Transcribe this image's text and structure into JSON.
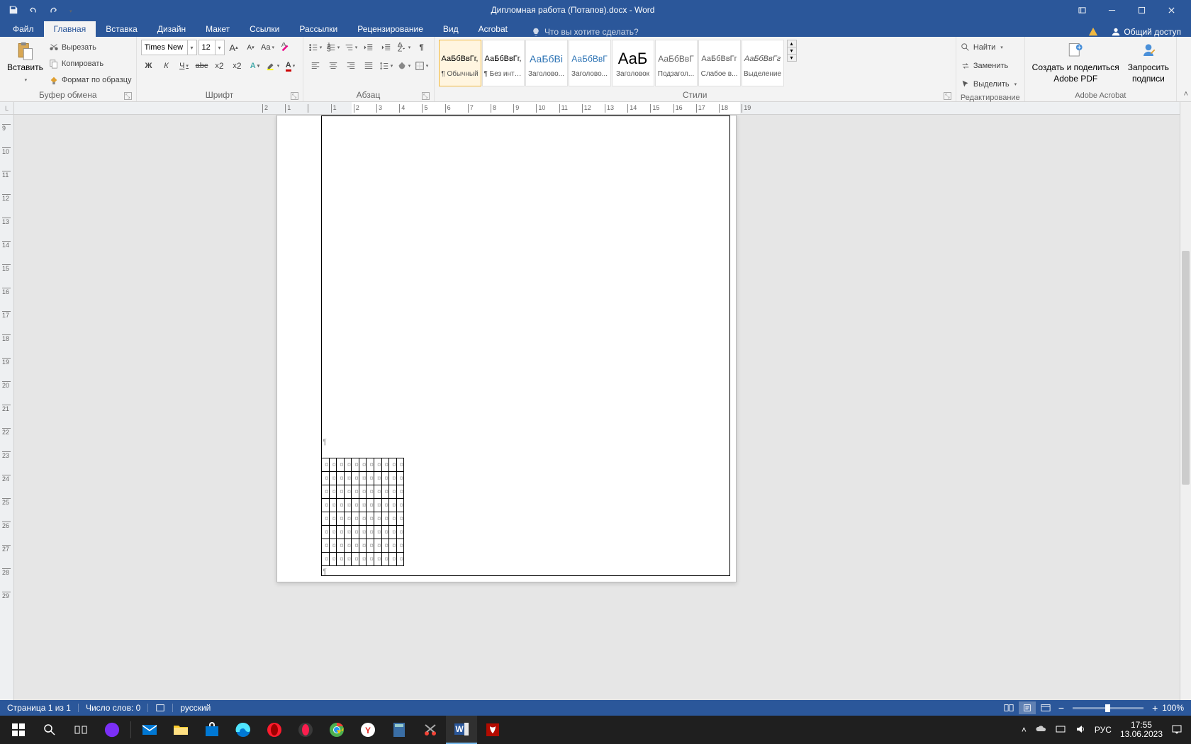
{
  "title": "Дипломная работа (Потапов).docx - Word",
  "qat": {
    "save": "save",
    "undo": "undo",
    "redo": "redo",
    "customize": "customize"
  },
  "tabs": {
    "file": "Файл",
    "home": "Главная",
    "insert": "Вставка",
    "design": "Дизайн",
    "layout": "Макет",
    "references": "Ссылки",
    "mailings": "Рассылки",
    "review": "Рецензирование",
    "view": "Вид",
    "acrobat": "Acrobat"
  },
  "tellme": "Что вы хотите сделать?",
  "shared_access": "Общий доступ",
  "ribbon": {
    "clipboard": {
      "paste": "Вставить",
      "cut": "Вырезать",
      "copy": "Копировать",
      "format_painter": "Формат по образцу",
      "label": "Буфер обмена"
    },
    "font": {
      "name": "Times New R",
      "size": "12",
      "bold": "Ж",
      "italic": "К",
      "underline": "Ч",
      "label": "Шрифт"
    },
    "paragraph": {
      "label": "Абзац"
    },
    "styles": {
      "label": "Стили",
      "items": [
        {
          "preview": "АаБбВвГг,",
          "name": "¶ Обычный"
        },
        {
          "preview": "АаБбВвГг,",
          "name": "¶ Без инте..."
        },
        {
          "preview": "АаБбВі",
          "name": "Заголово..."
        },
        {
          "preview": "АаБбВвГ",
          "name": "Заголово..."
        },
        {
          "preview": "АаБ",
          "name": "Заголовок"
        },
        {
          "preview": "АаБбВвГ",
          "name": "Подзагол..."
        },
        {
          "preview": "АаБбВвГг",
          "name": "Слабое в..."
        },
        {
          "preview": "АаБбВвГг",
          "name": "Выделение"
        }
      ]
    },
    "editing": {
      "find": "Найти",
      "replace": "Заменить",
      "select": "Выделить",
      "label": "Редактирование"
    },
    "acrobat": {
      "create_share_l1": "Создать и поделиться",
      "create_share_l2": "Adobe PDF",
      "request_l1": "Запросить",
      "request_l2": "подписи",
      "label": "Adobe Acrobat"
    }
  },
  "ruler_corner": "L",
  "status": {
    "page": "Страница 1 из 1",
    "words": "Число слов: 0",
    "language": "русский",
    "zoom": "100%"
  },
  "tray": {
    "lang": "РУС",
    "time": "17:55",
    "date": "13.06.2023"
  },
  "table": {
    "rows": 8,
    "cols": 11,
    "cell_mark": "¤"
  }
}
